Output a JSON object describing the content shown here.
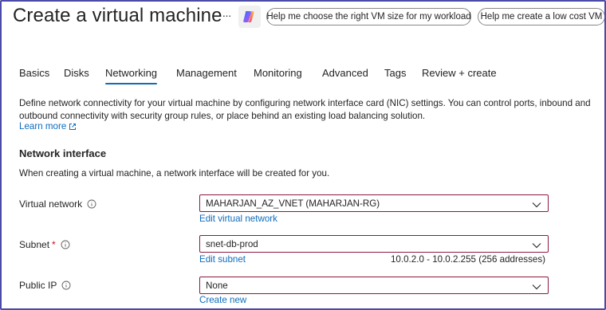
{
  "header": {
    "title": "Create a virtual machine",
    "more_glyph": "···",
    "copilot_icon": "copilot-icon",
    "suggestions": [
      {
        "label": "Help me choose the right VM size for my workload"
      },
      {
        "label": "Help me create a low cost VM"
      }
    ]
  },
  "tabs": [
    {
      "label": "Basics"
    },
    {
      "label": "Disks"
    },
    {
      "label": "Networking",
      "active": true
    },
    {
      "label": "Management"
    },
    {
      "label": "Monitoring"
    },
    {
      "label": "Advanced"
    },
    {
      "label": "Tags"
    },
    {
      "label": "Review + create"
    }
  ],
  "intro": {
    "text": "Define network connectivity for your virtual machine by configuring network interface card (NIC) settings. You can control ports, inbound and outbound connectivity with security group rules, or place behind an existing load balancing solution.",
    "learn_more": "Learn more",
    "learn_more_icon": "external-link-icon"
  },
  "network_interface": {
    "heading": "Network interface",
    "description": "When creating a virtual machine, a network interface will be created for you.",
    "fields": {
      "virtual_network": {
        "label": "Virtual network",
        "value": "MAHARJAN_AZ_VNET (MAHARJAN-RG)",
        "link": "Edit virtual network"
      },
      "subnet": {
        "label": "Subnet",
        "required_mark": "*",
        "value": "snet-db-prod",
        "link": "Edit subnet",
        "range": "10.0.2.0 - 10.0.2.255 (256 addresses)"
      },
      "public_ip": {
        "label": "Public IP",
        "value": "None",
        "link": "Create new"
      }
    }
  },
  "colors": {
    "accent": "#0f6cbd",
    "select_border": "#8b1a3a",
    "required": "#c50f1f",
    "frame_border": "#4a4aa8"
  }
}
